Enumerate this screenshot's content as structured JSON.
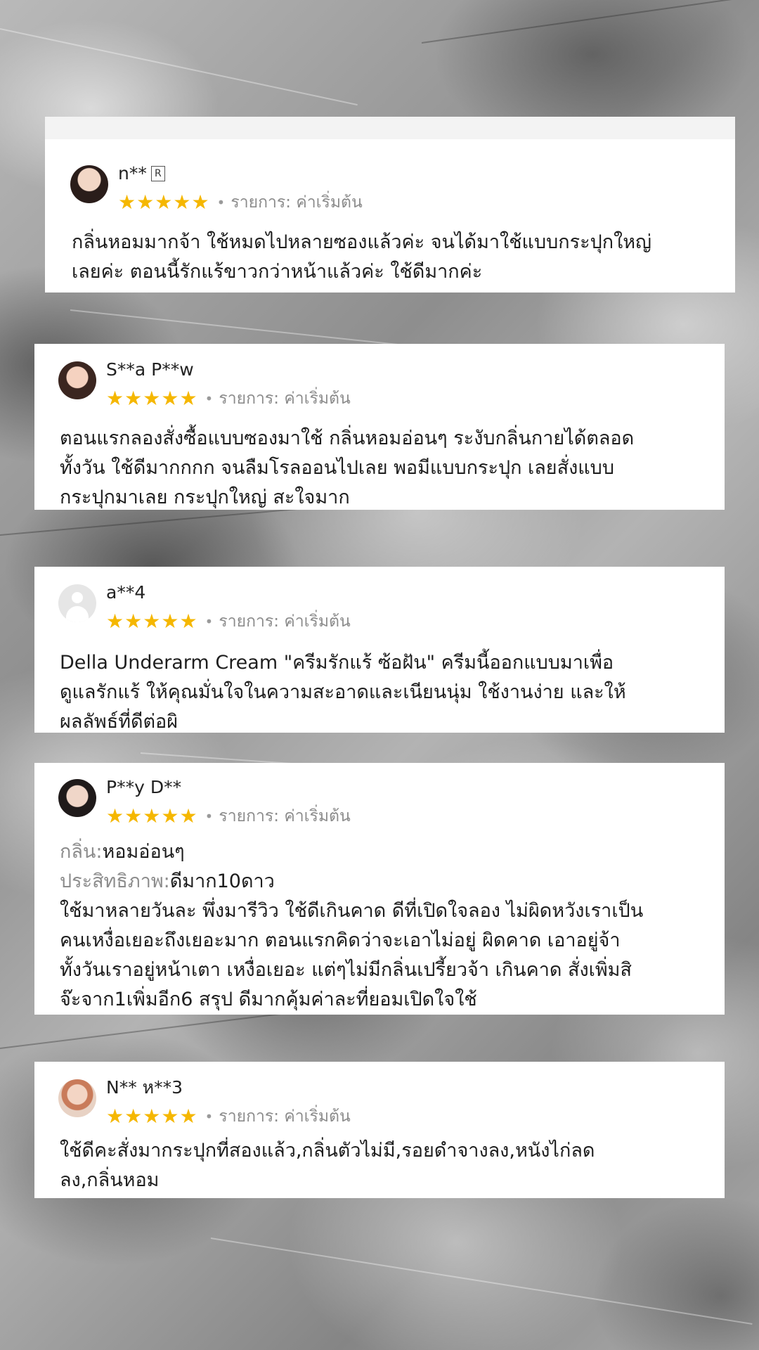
{
  "reviews": [
    {
      "username": "n**",
      "badge": "R",
      "rating": 5,
      "variation": "รายการ: ค่าเริ่มต้น",
      "avatar": "profile-photo",
      "text_lines": [
        "กลิ่นหอมมากจ้า ใช้หมดไปหลายซองแล้วค่ะ จนได้มาใช้แบบกระปุกใหญ่",
        "เลยค่ะ ตอนนี้รักแร้ขาวกว่าหน้าแล้วค่ะ ใช้ดีมากค่ะ"
      ]
    },
    {
      "username": "S**a P**w",
      "rating": 5,
      "variation": "รายการ: ค่าเริ่มต้น",
      "avatar": "profile-photo",
      "text_lines": [
        "ตอนแรกลองสั่งซื้อแบบซองมาใช้  กลิ่นหอมอ่อนๆ ระงับกลิ่นกายได้ตลอด",
        "ทั้งวัน ใช้ดีมากกกก จนลืมโรลออนไปเลย พอมีแบบกระปุก   เลยสั่งแบบ",
        "กระปุกมาเลย กระปุกใหญ่ สะใจมาก"
      ]
    },
    {
      "username": "a**4",
      "rating": 5,
      "variation": "รายการ: ค่าเริ่มต้น",
      "avatar": "default-avatar",
      "text_lines": [
        "Della Underarm Cream \"ครีมรักแร้ ซ้อฝัน\" ครีมนี้ออกแบบมาเพื่อ",
        "ดูแลรักแร้ ให้คุณมั่นใจในความสะอาดและเนียนนุ่ม ใช้งานง่าย และให้",
        "ผลลัพธ์ที่ดีต่อผิ"
      ]
    },
    {
      "username": "P**y D**",
      "rating": 5,
      "variation": "รายการ: ค่าเริ่มต้น",
      "avatar": "profile-photo",
      "attributes": [
        {
          "label": "กลิ่น:",
          "value": "หอมอ่อนๆ"
        },
        {
          "label": "ประสิทธิภาพ:",
          "value": "ดีมาก10ดาว"
        }
      ],
      "text_lines": [
        "ใช้มาหลายวันละ พึ่งมารีวิว ใช้ดีเกินคาด ดีที่เปิดใจลอง ไม่ผิดหวังเราเป็น",
        "คนเหงื่อเยอะถึงเยอะมาก ตอนแรกคิดว่าจะเอาไม่อยู่  ผิดคาด เอาอยู่จ้า",
        "ทั้งวันเราอยู่หน้าเตา เหงื่อเยอะ แต่ๆไม่มีกลิ่นเปรี้ยวจ้า เกินคาด สั่งเพิ่มสิ",
        "จ๊ะจาก1เพิ่มอีก6 สรุป ดีมากคุ้มค่าละที่ยอมเปิดใจใช้"
      ]
    },
    {
      "username": "N** ห**3",
      "rating": 5,
      "variation": "รายการ: ค่าเริ่มต้น",
      "avatar": "profile-photo",
      "text_lines": [
        "ใช้ดีคะสั่งมากระปุกที่สองแล้ว,กลิ่นตัวไม่มี,รอยดำจางลง,หนังไก่ลด",
        "ลง,กลิ่นหอม"
      ]
    }
  ],
  "colors": {
    "star": "#f5b700",
    "muted_text": "#8c8c8c",
    "body_text": "#1e1e1e",
    "card_bg": "#ffffff"
  },
  "icons": {
    "star": "star-icon",
    "badge": "registered-badge-icon",
    "default_avatar": "default-user-icon"
  }
}
